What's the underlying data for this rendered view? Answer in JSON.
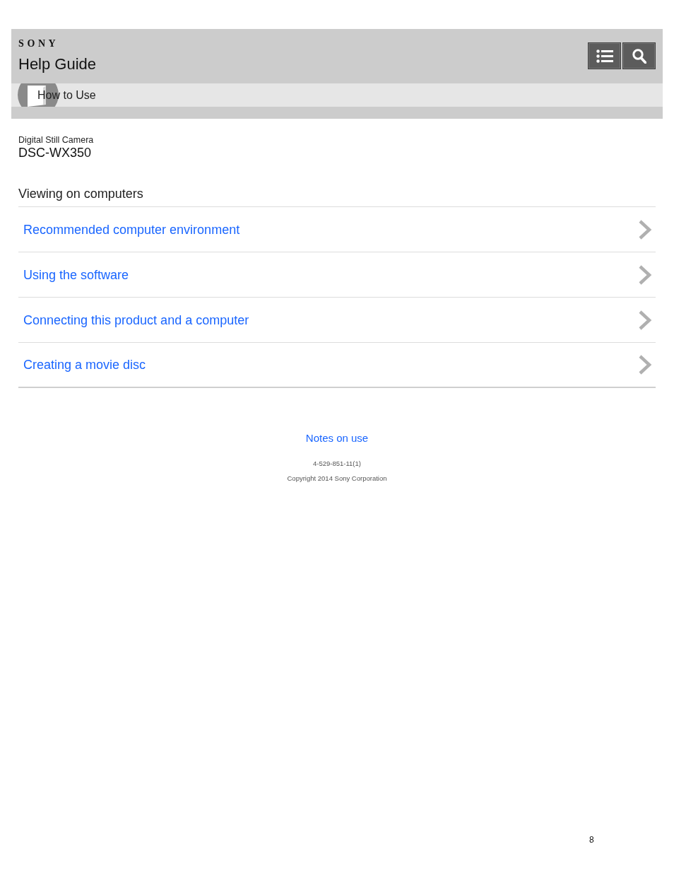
{
  "header": {
    "brand": "SONY",
    "title": "Help Guide",
    "buttons": [
      {
        "kind": "menu"
      },
      {
        "kind": "search"
      }
    ]
  },
  "breadcrumb": {
    "label": "How to Use"
  },
  "product": {
    "category": "Digital Still Camera",
    "model": "DSC-WX350"
  },
  "section": {
    "title": "Viewing on computers",
    "links": [
      "Recommended computer environment",
      "Using the software",
      "Connecting this product and a computer",
      "Creating a movie disc"
    ]
  },
  "footer": {
    "link": "Notes on use",
    "code": "4-529-851-11(1)",
    "copyright": "Copyright 2014 Sony Corporation"
  },
  "page_number": "8"
}
